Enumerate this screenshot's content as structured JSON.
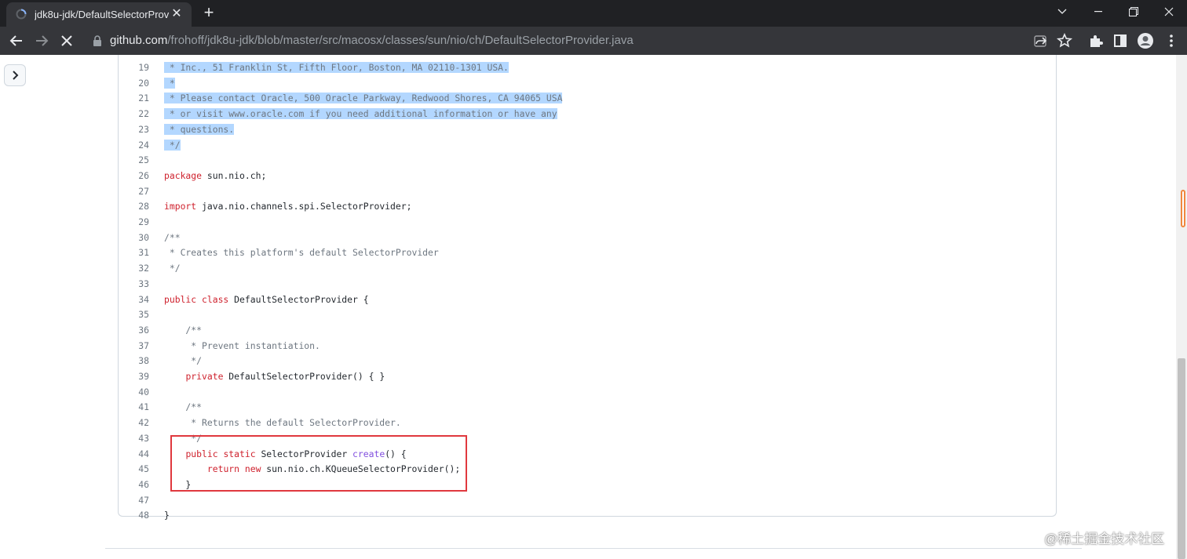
{
  "browser": {
    "tab_title": "jdk8u-jdk/DefaultSelectorProv",
    "new_tab_label": "+",
    "url_host": "github.com",
    "url_path": "/frohoff/jdk8u-jdk/blob/master/src/macosx/classes/sun/nio/ch/DefaultSelectorProvider.java",
    "tab_close_label": "✕"
  },
  "code": {
    "lines": [
      {
        "n": "19",
        "text": " * Inc., 51 Franklin St, Fifth Floor, Boston, MA 02110-1301 USA."
      },
      {
        "n": "20",
        "text": " *"
      },
      {
        "n": "21",
        "text": " * Please contact Oracle, 500 Oracle Parkway, Redwood Shores, CA 94065 USA"
      },
      {
        "n": "22",
        "text": " * or visit www.oracle.com if you need additional information or have any"
      },
      {
        "n": "23",
        "text": " * questions."
      },
      {
        "n": "24",
        "text": " */"
      },
      {
        "n": "25",
        "text": ""
      },
      {
        "n": "26",
        "kw": "package",
        "text": " sun.nio.ch;"
      },
      {
        "n": "27",
        "text": ""
      },
      {
        "n": "28",
        "kw": "import",
        "text": " java.nio.channels.spi.SelectorProvider;"
      },
      {
        "n": "29",
        "text": ""
      },
      {
        "n": "30",
        "text": "/**"
      },
      {
        "n": "31",
        "text": " * Creates this platform's default SelectorProvider"
      },
      {
        "n": "32",
        "text": " */"
      },
      {
        "n": "33",
        "text": ""
      },
      {
        "n": "34",
        "kw": "public class",
        "text": " DefaultSelectorProvider {"
      },
      {
        "n": "35",
        "text": ""
      },
      {
        "n": "36",
        "text": "    /**"
      },
      {
        "n": "37",
        "text": "     * Prevent instantiation."
      },
      {
        "n": "38",
        "text": "     */"
      },
      {
        "n": "39",
        "indent": "    ",
        "kw": "private",
        "text": " DefaultSelectorProvider() { }"
      },
      {
        "n": "40",
        "text": ""
      },
      {
        "n": "41",
        "text": "    /**"
      },
      {
        "n": "42",
        "text": "     * Returns the default SelectorProvider."
      },
      {
        "n": "43",
        "text": "     */"
      },
      {
        "n": "44",
        "indent": "    ",
        "kw": "public static",
        "text": " SelectorProvider ",
        "fn": "create",
        "rest": "() {"
      },
      {
        "n": "45",
        "indent": "        ",
        "kw": "return new",
        "text": " sun.nio.ch.KQueueSelectorProvider();"
      },
      {
        "n": "46",
        "text": "    }"
      },
      {
        "n": "47",
        "text": ""
      },
      {
        "n": "48",
        "text": "}"
      }
    ]
  },
  "watermark": "@稀土掘金技术社区",
  "colors": {
    "keyword": "#cf222e",
    "comment": "#6e7781",
    "function": "#8250df",
    "selection": "#b3d7ff",
    "highlight_box": "#e0383e",
    "scroll_marker": "#f0883e"
  }
}
